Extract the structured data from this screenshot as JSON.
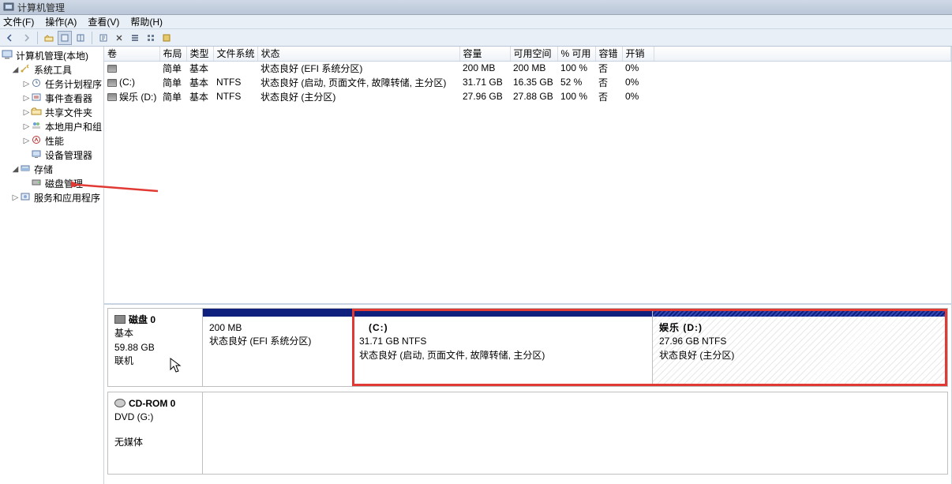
{
  "window": {
    "title": "计算机管理"
  },
  "menu": {
    "file": "文件(F)",
    "action": "操作(A)",
    "view": "查看(V)",
    "help": "帮助(H)"
  },
  "tree": {
    "root": "计算机管理(本地)",
    "system_tools": "系统工具",
    "task_scheduler": "任务计划程序",
    "event_viewer": "事件查看器",
    "shared_folders": "共享文件夹",
    "local_users": "本地用户和组",
    "performance": "性能",
    "device_manager": "设备管理器",
    "storage": "存储",
    "disk_management": "磁盘管理",
    "services_apps": "服务和应用程序"
  },
  "columns": {
    "volume": "卷",
    "layout": "布局",
    "type": "类型",
    "filesystem": "文件系统",
    "status": "状态",
    "capacity": "容量",
    "free": "可用空间",
    "pctfree": "% 可用",
    "fault": "容错",
    "overhead": "开销"
  },
  "rows": [
    {
      "volume": "",
      "layout": "简单",
      "type": "基本",
      "filesystem": "",
      "status": "状态良好 (EFI 系统分区)",
      "capacity": "200 MB",
      "free": "200 MB",
      "pctfree": "100 %",
      "fault": "否",
      "overhead": "0%"
    },
    {
      "volume": "(C:)",
      "layout": "简单",
      "type": "基本",
      "filesystem": "NTFS",
      "status": "状态良好 (启动, 页面文件, 故障转储, 主分区)",
      "capacity": "31.71 GB",
      "free": "16.35 GB",
      "pctfree": "52 %",
      "fault": "否",
      "overhead": "0%"
    },
    {
      "volume": "娱乐 (D:)",
      "layout": "简单",
      "type": "基本",
      "filesystem": "NTFS",
      "status": "状态良好 (主分区)",
      "capacity": "27.96 GB",
      "free": "27.88 GB",
      "pctfree": "100 %",
      "fault": "否",
      "overhead": "0%"
    }
  ],
  "disk0": {
    "name": "磁盘 0",
    "type": "基本",
    "size": "59.88 GB",
    "state": "联机",
    "parts": [
      {
        "label": "",
        "size": "200 MB",
        "status": "状态良好 (EFI 系统分区)"
      },
      {
        "label": "(C:)",
        "size": "31.71 GB NTFS",
        "status": "状态良好 (启动, 页面文件, 故障转储, 主分区)"
      },
      {
        "label": "娱乐  (D:)",
        "size": "27.96 GB NTFS",
        "status": "状态良好 (主分区)"
      }
    ]
  },
  "cdrom": {
    "name": "CD-ROM 0",
    "type": "DVD (G:)",
    "state": "无媒体"
  }
}
